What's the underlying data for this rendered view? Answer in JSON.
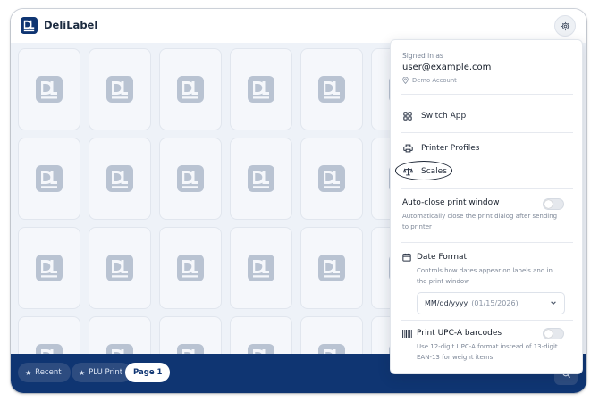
{
  "app": {
    "title": "DeliLabel"
  },
  "colors": {
    "primary": "#0f3572",
    "chip": "#2d4c80",
    "grid_bg": "#eef2f8",
    "tile_icon": "#b9c3d2"
  },
  "icons": {
    "settings": "gear-icon",
    "search": "search-icon",
    "tile": "delilabel-logo-icon",
    "chip": "star-icon"
  },
  "bottom_bar": {
    "chips": [
      {
        "label": "Recent",
        "icon": "star-icon"
      },
      {
        "label": "PLU Print",
        "icon": "star-icon"
      },
      {
        "label": "Page 1",
        "active": true
      }
    ]
  },
  "menu": {
    "signed_in_label": "Signed in as",
    "email": "user@example.com",
    "account": "Demo Account",
    "items": [
      {
        "label": "Switch App",
        "icon": "grid-icon"
      },
      {
        "label": "Printer Profiles",
        "icon": "printer-icon"
      },
      {
        "label": "Scales",
        "icon": "scale-icon"
      }
    ],
    "auto_close": {
      "title": "Auto-close print window",
      "desc_line1": "Automatically close the print dialog after sending",
      "desc_line2": "to printer",
      "enabled": false
    },
    "date_format": {
      "title": "Date Format",
      "desc_line1": "Controls how dates appear on labels and in",
      "desc_line2": "the print window",
      "selected": "MM/dd/yyyy",
      "example": "(01/15/2026)"
    },
    "upc": {
      "title": "Print UPC-A barcodes",
      "desc_line1": "Use 12-digit UPC-A format instead of 13-digit",
      "desc_line2": "EAN-13 for weight items.",
      "enabled": false
    }
  }
}
